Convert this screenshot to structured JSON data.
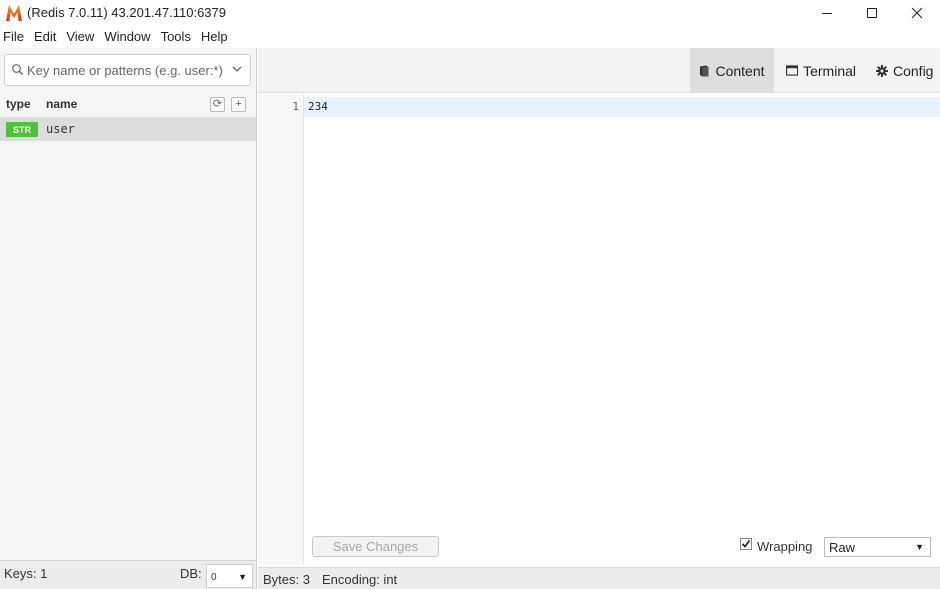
{
  "window": {
    "title": "(Redis 7.0.11) 43.201.47.110:6379"
  },
  "menu": [
    "File",
    "Edit",
    "View",
    "Window",
    "Tools",
    "Help"
  ],
  "search": {
    "placeholder": "Key name or patterns (e.g. user:*)"
  },
  "key_list": {
    "headers": {
      "type": "type",
      "name": "name"
    },
    "refresh_label": "⟳",
    "add_label": "+",
    "items": [
      {
        "type": "STR",
        "name": "user",
        "type_color": "#4fc13c"
      }
    ]
  },
  "left_footer": {
    "keys_label": "Keys: 1",
    "db_label": "DB:",
    "db_value": "0"
  },
  "tabs": [
    {
      "label": "Content",
      "icon": "book-icon",
      "active": true
    },
    {
      "label": "Terminal",
      "icon": "window-icon",
      "active": false
    },
    {
      "label": "Config",
      "icon": "gear-icon",
      "active": false
    }
  ],
  "editor": {
    "lines": [
      {
        "number": "1",
        "text": "234"
      }
    ]
  },
  "toolbar": {
    "save_label": "Save Changes",
    "wrapping_label": "Wrapping",
    "wrapping_checked": true,
    "format_value": "Raw"
  },
  "status": {
    "bytes": "Bytes: 3",
    "encoding": "Encoding: int"
  },
  "colors": {
    "accent_active_tab": "#dedede",
    "badge_string": "#4fc13c",
    "active_line": "#e8f2fe"
  }
}
